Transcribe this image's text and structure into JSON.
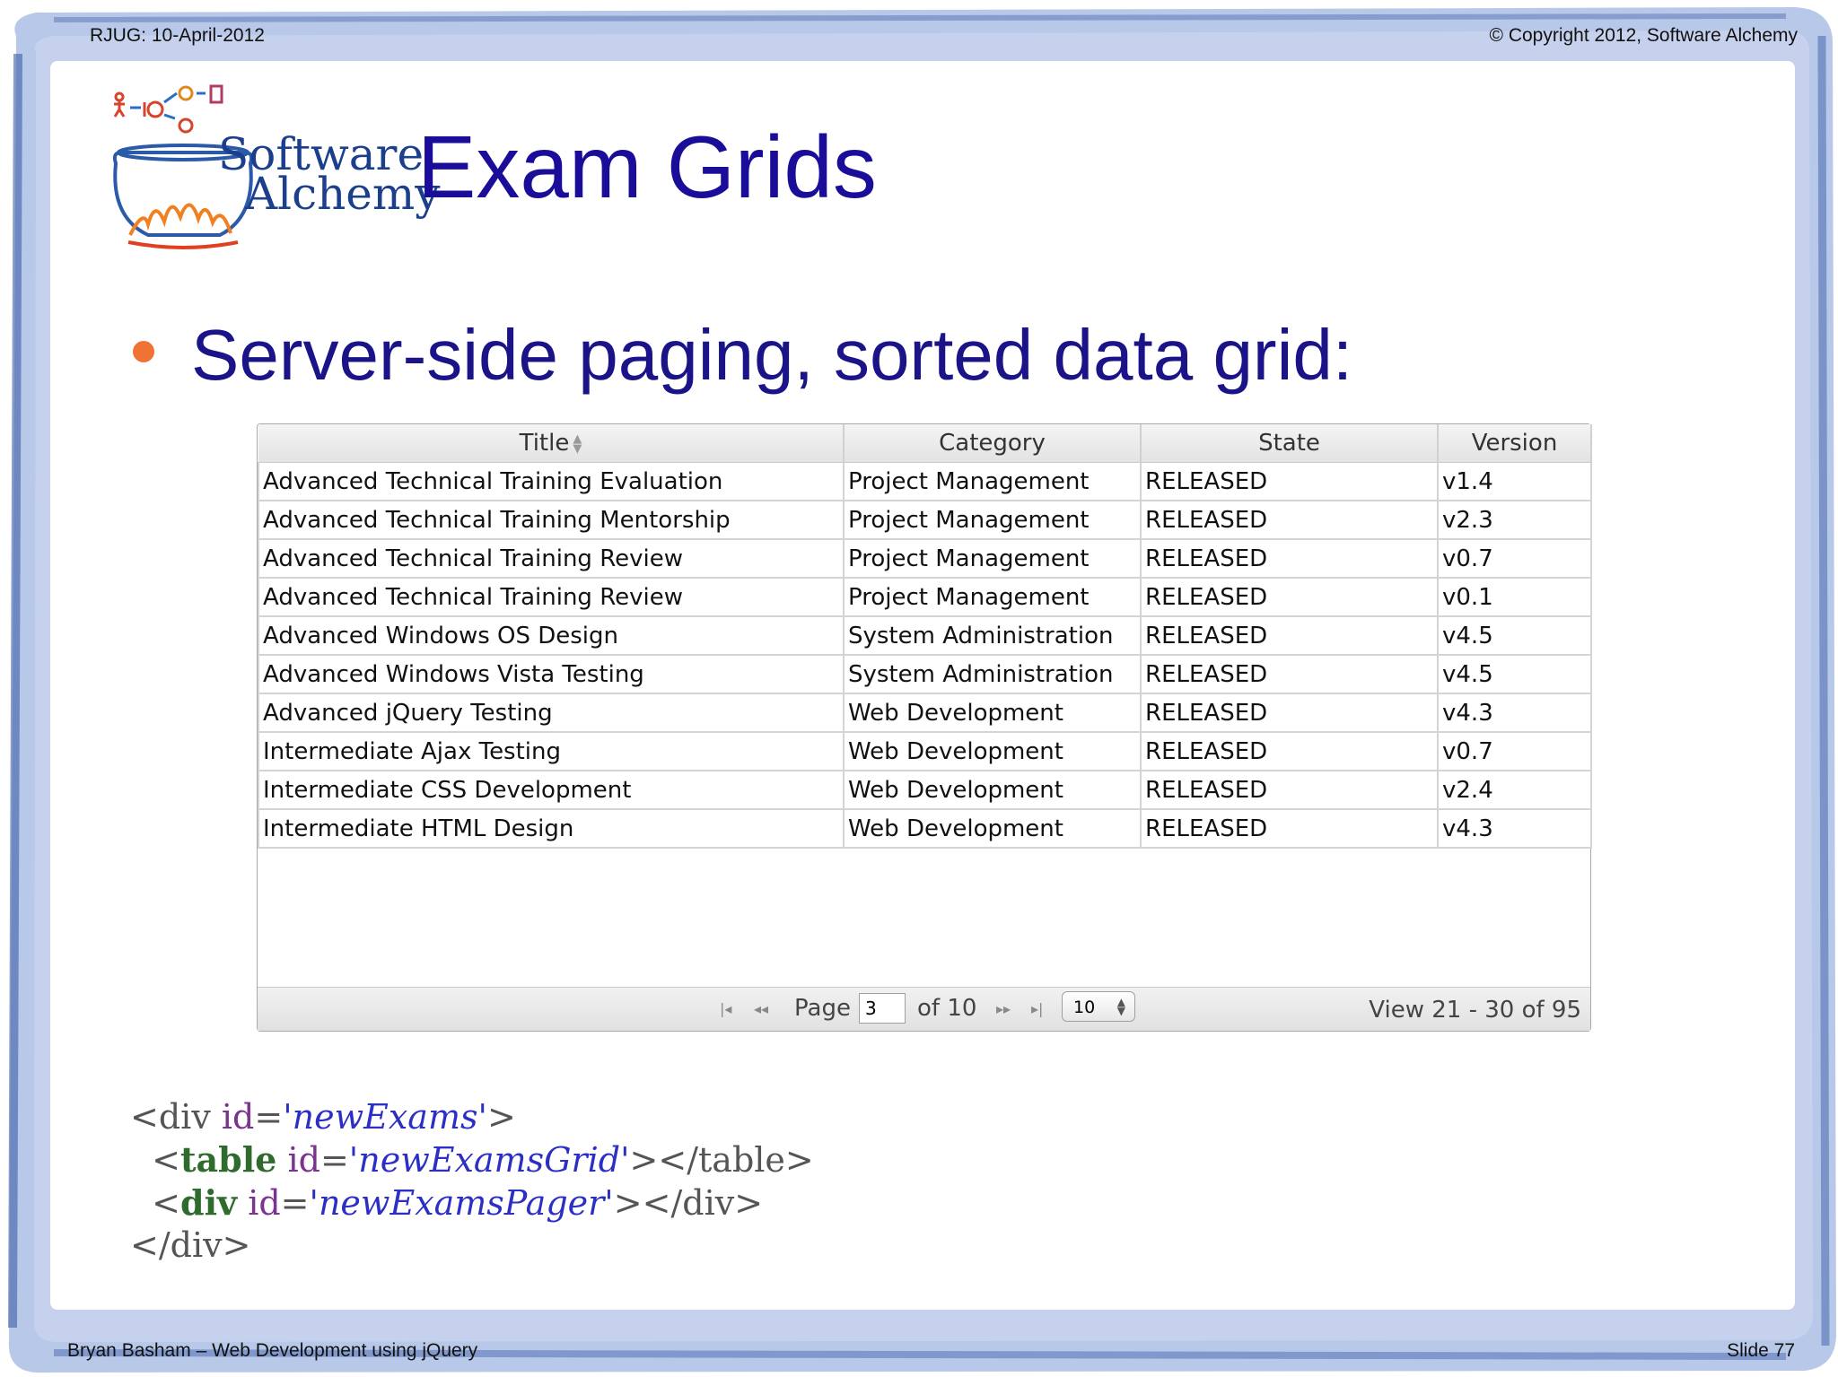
{
  "header": {
    "left": "RJUG:  10-April-2012",
    "right": "© Copyright 2012, Software Alchemy"
  },
  "footer": {
    "left": "Bryan Basham – Web Development using jQuery",
    "right": "Slide 77"
  },
  "logo": {
    "line1": "Software",
    "line2": "Alchemy"
  },
  "title": "Exam Grids",
  "bullet": "Server-side paging, sorted data grid:",
  "grid": {
    "columns": [
      "Title",
      "Category",
      "State",
      "Version"
    ],
    "rows": [
      [
        "Advanced Technical Training Evaluation",
        "Project Management",
        "RELEASED",
        "v1.4"
      ],
      [
        "Advanced Technical Training Mentorship",
        "Project Management",
        "RELEASED",
        "v2.3"
      ],
      [
        "Advanced Technical Training Review",
        "Project Management",
        "RELEASED",
        "v0.7"
      ],
      [
        "Advanced Technical Training Review",
        "Project Management",
        "RELEASED",
        "v0.1"
      ],
      [
        "Advanced Windows OS Design",
        "System Administration",
        "RELEASED",
        "v4.5"
      ],
      [
        "Advanced Windows Vista Testing",
        "System Administration",
        "RELEASED",
        "v4.5"
      ],
      [
        "Advanced jQuery Testing",
        "Web Development",
        "RELEASED",
        "v4.3"
      ],
      [
        "Intermediate Ajax Testing",
        "Web Development",
        "RELEASED",
        "v0.7"
      ],
      [
        "Intermediate CSS Development",
        "Web Development",
        "RELEASED",
        "v2.4"
      ],
      [
        "Intermediate HTML Design",
        "Web Development",
        "RELEASED",
        "v4.3"
      ]
    ],
    "pager": {
      "first_icon": "first-page-icon",
      "prev_icon": "prev-page-icon",
      "next_icon": "next-page-icon",
      "last_icon": "last-page-icon",
      "page_label": "Page",
      "page_value": "3",
      "of_label": "of 10",
      "rows_per_page": "10",
      "view_text": "View 21 - 30 of 95"
    }
  },
  "code": {
    "l1_open": "<div ",
    "l1_attr": "id",
    "l1_eq": "=",
    "l1_str": "'newExams'",
    "l1_close": ">",
    "l2_open": "  <",
    "l2_tag": "table",
    "l2_sp": " ",
    "l2_attr": "id",
    "l2_eq": "=",
    "l2_str": "'newExamsGrid'",
    "l2_close": "></table>",
    "l3_open": "  <",
    "l3_tag": "div",
    "l3_sp": " ",
    "l3_attr": "id",
    "l3_eq": "=",
    "l3_str": "'newExamsPager'",
    "l3_close": "></div>",
    "l4": "</div>"
  },
  "colors": {
    "title": "#1a0d99",
    "bullet_dot": "#f07235",
    "frame": "#5b7fc6"
  }
}
